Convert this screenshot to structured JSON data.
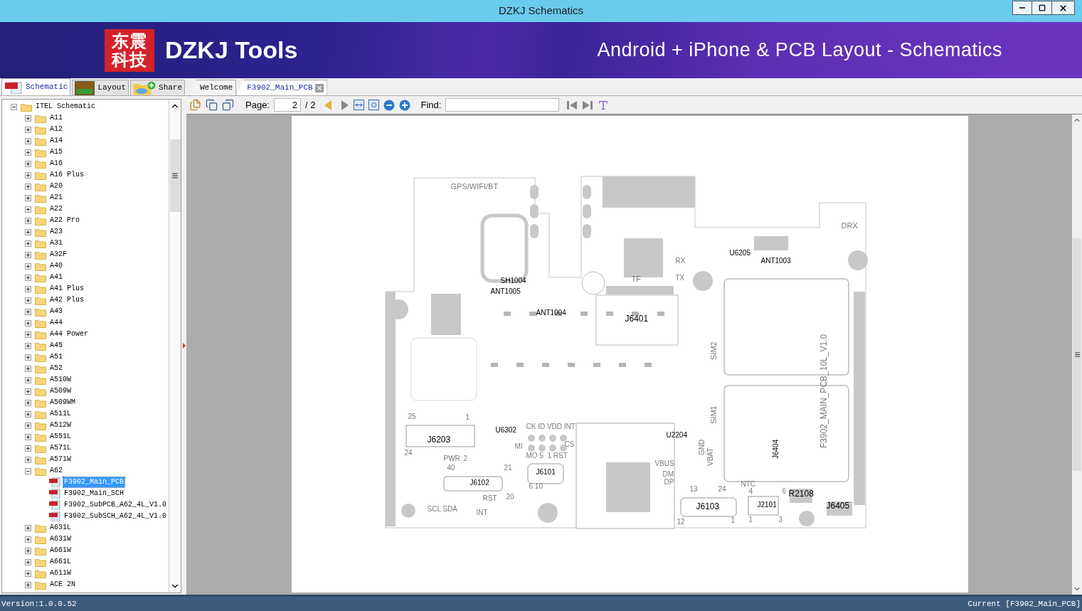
{
  "window": {
    "title": "DZKJ Schematics"
  },
  "banner": {
    "logo_lines": [
      "东震",
      "科技"
    ],
    "brand": "DZKJ Tools",
    "tagline": "Android + iPhone & PCB Layout - Schematics"
  },
  "panel_tabs": [
    {
      "label": "Schematic",
      "kind": "pdf",
      "selected": true
    },
    {
      "label": "Layout",
      "kind": "pads",
      "selected": false
    },
    {
      "label": "Share",
      "kind": "cloud",
      "selected": false
    }
  ],
  "doc_tabs": [
    {
      "label": "Welcome",
      "selected": false,
      "closable": false
    },
    {
      "label": "F3902_Main_PCB",
      "selected": true,
      "closable": true
    }
  ],
  "toolbar": {
    "page_label": "Page:",
    "page_value": "2",
    "page_total": "/ 2",
    "find_label": "Find:"
  },
  "tree": {
    "label": "ITEL Schematic",
    "kind": "folder",
    "expanded": true,
    "children": [
      {
        "label": "A11",
        "kind": "folder",
        "expanded": false
      },
      {
        "label": "A12",
        "kind": "folder",
        "expanded": false
      },
      {
        "label": "A14",
        "kind": "folder",
        "expanded": false
      },
      {
        "label": "A15",
        "kind": "folder",
        "expanded": false
      },
      {
        "label": "A16",
        "kind": "folder",
        "expanded": false
      },
      {
        "label": "A16 Plus",
        "kind": "folder",
        "expanded": false
      },
      {
        "label": "A20",
        "kind": "folder",
        "expanded": false
      },
      {
        "label": "A21",
        "kind": "folder",
        "expanded": false
      },
      {
        "label": "A22",
        "kind": "folder",
        "expanded": false
      },
      {
        "label": "A22 Pro",
        "kind": "folder",
        "expanded": false
      },
      {
        "label": "A23",
        "kind": "folder",
        "expanded": false
      },
      {
        "label": "A31",
        "kind": "folder",
        "expanded": false
      },
      {
        "label": "A32F",
        "kind": "folder",
        "expanded": false
      },
      {
        "label": "A40",
        "kind": "folder",
        "expanded": false
      },
      {
        "label": "A41",
        "kind": "folder",
        "expanded": false
      },
      {
        "label": "A41 Plus",
        "kind": "folder",
        "expanded": false
      },
      {
        "label": "A42 Plus",
        "kind": "folder",
        "expanded": false
      },
      {
        "label": "A43",
        "kind": "folder",
        "expanded": false
      },
      {
        "label": "A44",
        "kind": "folder",
        "expanded": false
      },
      {
        "label": "A44 Power",
        "kind": "folder",
        "expanded": false
      },
      {
        "label": "A45",
        "kind": "folder",
        "expanded": false
      },
      {
        "label": "A51",
        "kind": "folder",
        "expanded": false
      },
      {
        "label": "A52",
        "kind": "folder",
        "expanded": false
      },
      {
        "label": "A510W",
        "kind": "folder",
        "expanded": false
      },
      {
        "label": "A509W",
        "kind": "folder",
        "expanded": false
      },
      {
        "label": "A509WM",
        "kind": "folder",
        "expanded": false
      },
      {
        "label": "A511L",
        "kind": "folder",
        "expanded": false
      },
      {
        "label": "A512W",
        "kind": "folder",
        "expanded": false
      },
      {
        "label": "A551L",
        "kind": "folder",
        "expanded": false
      },
      {
        "label": "A571L",
        "kind": "folder",
        "expanded": false
      },
      {
        "label": "A571W",
        "kind": "folder",
        "expanded": false
      },
      {
        "label": "A62",
        "kind": "folder",
        "expanded": true,
        "children": [
          {
            "label": "F3902_Main_PCB",
            "kind": "pdf",
            "selected": true
          },
          {
            "label": "F3902_Main_SCH",
            "kind": "pdf",
            "selected": false
          },
          {
            "label": "F3902_SubPCB_A62_4L_V1.0",
            "kind": "pdf",
            "selected": false
          },
          {
            "label": "F3902_SubSCH_A62_4L_V1.0",
            "kind": "pdf",
            "selected": false
          }
        ]
      },
      {
        "label": "A631L",
        "kind": "folder",
        "expanded": false
      },
      {
        "label": "A631W",
        "kind": "folder",
        "expanded": false
      },
      {
        "label": "A661W",
        "kind": "folder",
        "expanded": false
      },
      {
        "label": "A661L",
        "kind": "folder",
        "expanded": false
      },
      {
        "label": "A611W",
        "kind": "folder",
        "expanded": false
      },
      {
        "label": "ACE 2N",
        "kind": "folder",
        "expanded": false
      }
    ]
  },
  "pcb": {
    "labels": [
      "GPS/WIFI/BT",
      "SH1004",
      "ANT1005",
      "ANT1004",
      "TF",
      "J6401",
      "RX",
      "TX",
      "U6205",
      "ANT1003",
      "DRX",
      "SIM2",
      "SIM1",
      "GND",
      "VBAT",
      "J6404",
      "F3902_MAIN_PCB_10L_V1.0",
      "25",
      "1",
      "J6203",
      "24",
      "PWR",
      "2",
      "40",
      "21",
      "J6102",
      "RST",
      "20",
      "SCL SDA",
      "INT",
      "U6302",
      "CK ID VDD INT",
      "MI",
      "CS",
      "MO 5",
      "1 RST",
      "J6101",
      "6 10",
      "U2204",
      "VBUS",
      "DM",
      "DP",
      "13",
      "24",
      "J6103",
      "12",
      "1",
      "NTC",
      "4",
      "6",
      "J2101",
      "1",
      "3",
      "R2108",
      "J6405"
    ]
  },
  "status_bar": {
    "version": "Version:1.0.0.52",
    "current": "Current [F3902_Main_PCB]"
  }
}
